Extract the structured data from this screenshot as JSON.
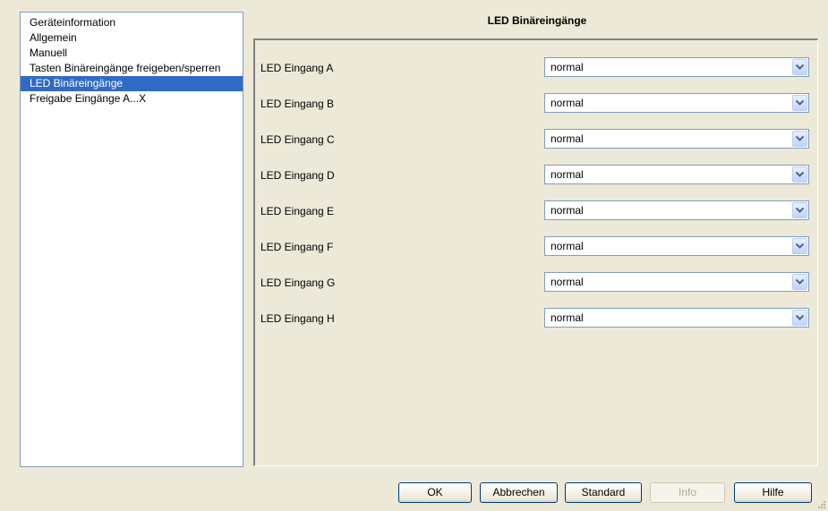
{
  "sidebar": {
    "items": [
      {
        "label": "Geräteinformation",
        "selected": false
      },
      {
        "label": "Allgemein",
        "selected": false
      },
      {
        "label": "Manuell",
        "selected": false
      },
      {
        "label": "Tasten Binäreingänge freigeben/sperren",
        "selected": false
      },
      {
        "label": "LED Binäreingänge",
        "selected": true
      },
      {
        "label": "Freigabe Eingänge A...X",
        "selected": false
      }
    ]
  },
  "main": {
    "title": "LED Binäreingänge",
    "rows": [
      {
        "label": "LED Eingang A",
        "value": "normal"
      },
      {
        "label": "LED Eingang B",
        "value": "normal"
      },
      {
        "label": "LED Eingang C",
        "value": "normal"
      },
      {
        "label": "LED Eingang D",
        "value": "normal"
      },
      {
        "label": "LED Eingang E",
        "value": "normal"
      },
      {
        "label": "LED Eingang F",
        "value": "normal"
      },
      {
        "label": "LED Eingang G",
        "value": "normal"
      },
      {
        "label": "LED Eingang H",
        "value": "normal"
      }
    ]
  },
  "footer": {
    "ok_label": "OK",
    "cancel_label": "Abbrechen",
    "standard_label": "Standard",
    "info_label": "Info",
    "help_label": "Hilfe"
  },
  "colors": {
    "selection": "#316ac5",
    "dialog_background": "#ece9d8"
  },
  "icons": {
    "dropdown": "chevron-down-icon",
    "resize": "resize-grip-icon"
  }
}
